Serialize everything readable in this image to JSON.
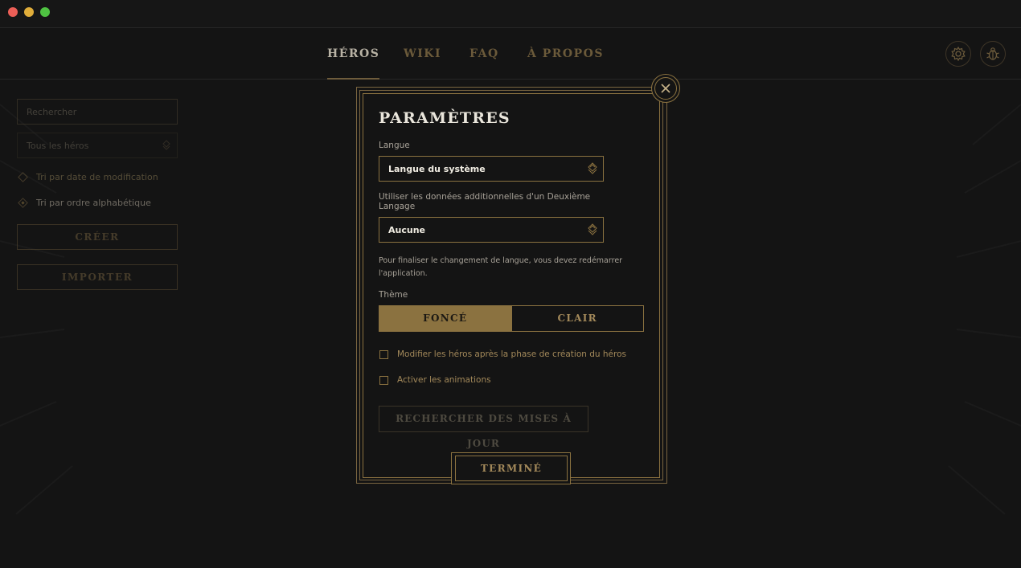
{
  "nav": {
    "tabs": [
      {
        "label": "HÉROS",
        "active": true
      },
      {
        "label": "WIKI",
        "active": false
      },
      {
        "label": "FAQ",
        "active": false
      },
      {
        "label": "À PROPOS",
        "active": false
      }
    ],
    "icons": [
      "gear-icon",
      "bug-icon"
    ]
  },
  "sidebar": {
    "search_placeholder": "Rechercher",
    "filter_value": "Tous les héros",
    "sort_options": [
      {
        "label": "Tri par date de modification",
        "selected": false
      },
      {
        "label": "Tri par ordre alphabétique",
        "selected": true
      }
    ],
    "create_label": "CRÉER",
    "import_label": "IMPORTER"
  },
  "modal": {
    "title": "PARAMÈTRES",
    "language_label": "Langue",
    "language_value": "Langue du système",
    "second_language_label": "Utiliser les données additionnelles d'un Deuxième Langage",
    "second_language_value": "Aucune",
    "restart_note": "Pour finaliser le changement de langue, vous devez redémarrer l'application.",
    "theme_label": "Thème",
    "theme_dark": "FONCÉ",
    "theme_light": "CLAIR",
    "selected_theme": "FONCÉ",
    "checkbox_edit_heroes": "Modifier les héros après la phase de création du héros",
    "checkbox_edit_heroes_checked": false,
    "checkbox_animations": "Activer les animations",
    "checkbox_animations_checked": false,
    "check_updates_label": "RECHERCHER DES MISES À JOUR",
    "done_label": "TERMINÉ"
  },
  "colors": {
    "accent": "#8b7240",
    "background": "#141414",
    "text_light": "#eae6dc"
  }
}
